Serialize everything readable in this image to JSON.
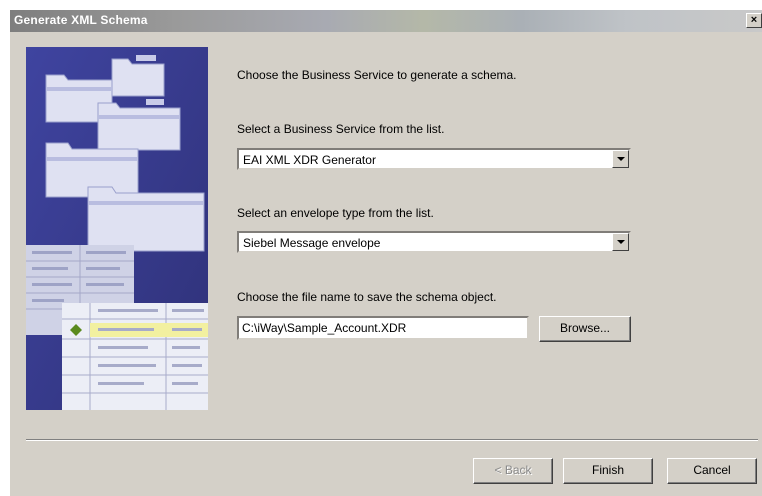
{
  "window": {
    "title": "Generate XML Schema",
    "close_label": "×"
  },
  "instructions": {
    "intro": "Choose the Business Service to generate a schema.",
    "service_label": "Select a Business Service from the list.",
    "envelope_label": "Select an envelope type from the list.",
    "file_label": "Choose the file name to save the schema object."
  },
  "business_service": {
    "selected": "EAI XML XDR Generator"
  },
  "envelope": {
    "selected": "Siebel Message envelope"
  },
  "file": {
    "value": "C:\\iWay\\Sample_Account.XDR",
    "browse_label": "Browse..."
  },
  "buttons": {
    "back": "< Back",
    "finish": "Finish",
    "cancel": "Cancel"
  },
  "colors": {
    "dialog_bg": "#d4d0c8",
    "art_bg": "#3a3c8c"
  }
}
